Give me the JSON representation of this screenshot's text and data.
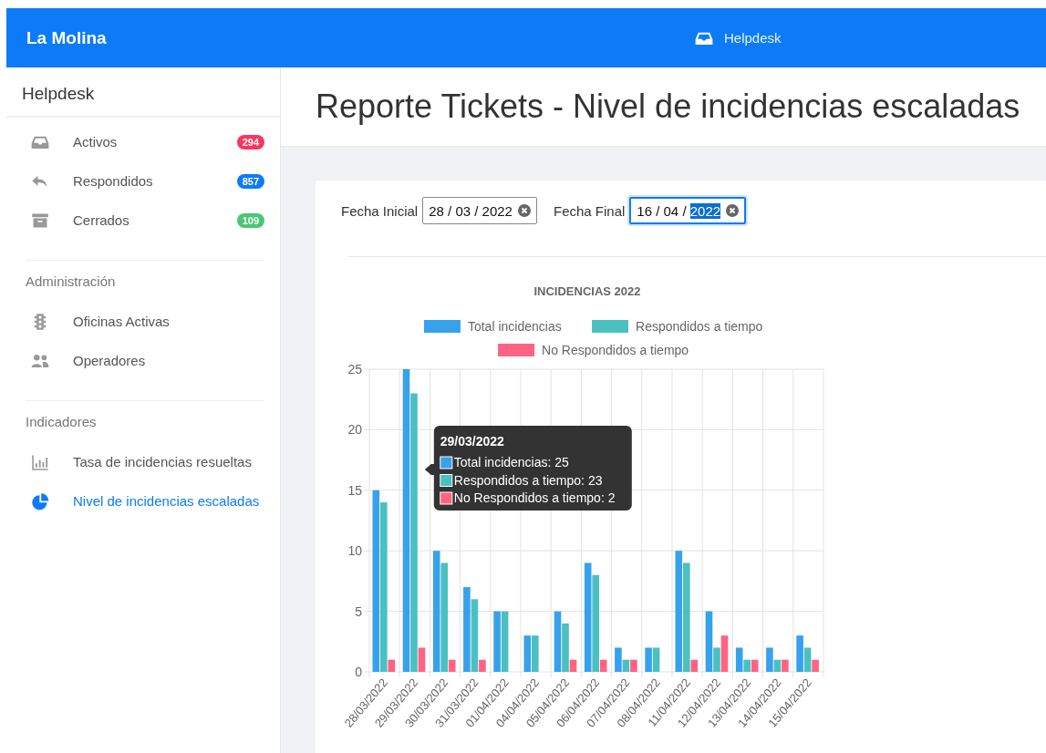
{
  "topbar": {
    "brand": "La Molina",
    "center_label": "Helpdesk"
  },
  "sidebar": {
    "title": "Helpdesk",
    "sections": [
      {
        "items": [
          {
            "label": "Activos",
            "kind": "inbox",
            "badge": "294",
            "color": "#f8355f",
            "selected": false
          },
          {
            "label": "Respondidos",
            "kind": "reply",
            "badge": "857",
            "color": "#0d7bf7",
            "selected": false
          },
          {
            "label": "Cerrados",
            "kind": "archive",
            "badge": "109",
            "color": "#48c774",
            "selected": false
          }
        ]
      },
      {
        "heading": "Administración",
        "items": [
          {
            "label": "Oficinas Activas",
            "kind": "traffic",
            "selected": false
          },
          {
            "label": "Operadores",
            "kind": "users",
            "selected": false
          }
        ]
      },
      {
        "heading": "Indicadores",
        "items": [
          {
            "label": "Tasa de incidencias resueltas",
            "kind": "bars",
            "selected": false
          },
          {
            "label": "Nivel de incidencias escaladas",
            "kind": "pie",
            "selected": true
          }
        ]
      }
    ]
  },
  "page": {
    "title": "Reporte Tickets - Nivel de incidencias escaladas"
  },
  "filters": [
    {
      "label": "Fecha Inicial",
      "focused": false,
      "segments": [
        {
          "text": "28 / 03 / 2022",
          "selected": false
        }
      ]
    },
    {
      "label": "Fecha Final",
      "focused": true,
      "segments": [
        {
          "text": "16 / 04 / ",
          "selected": false
        },
        {
          "text": "2022",
          "selected": true
        }
      ]
    }
  ],
  "chart": {
    "chart_data": {
      "type": "bar",
      "title": "INCIDENCIAS 2022",
      "categories": [
        "28/03/2022",
        "29/03/2022",
        "30/03/2022",
        "31/03/2022",
        "01/04/2022",
        "04/04/2022",
        "05/04/2022",
        "06/04/2022",
        "07/04/2022",
        "08/04/2022",
        "11/04/2022",
        "12/04/2022",
        "13/04/2022",
        "14/04/2022",
        "15/04/2022"
      ],
      "series": [
        {
          "name": "Total incidencias",
          "color": "#36a2eb",
          "values": [
            15,
            25,
            10,
            7,
            5,
            3,
            5,
            9,
            2,
            2,
            10,
            5,
            2,
            2,
            3
          ]
        },
        {
          "name": "Respondidos a tiempo",
          "color": "#4bc0c0",
          "values": [
            14,
            23,
            9,
            6,
            5,
            3,
            4,
            8,
            1,
            2,
            9,
            2,
            1,
            1,
            2
          ]
        },
        {
          "name": "No Respondidos a tiempo",
          "color": "#ff6384",
          "values": [
            1,
            2,
            1,
            1,
            0,
            0,
            1,
            1,
            1,
            0,
            1,
            3,
            1,
            1,
            1
          ]
        }
      ],
      "ylim": [
        0,
        25
      ],
      "grid": true,
      "legend": true,
      "yticks": [
        0,
        5,
        10,
        15,
        20,
        25
      ]
    },
    "tooltip": {
      "title": "29/03/2022",
      "lines": [
        {
          "text": "Total incidencias: 25",
          "color": "#36a2eb"
        },
        {
          "text": "Respondidos a tiempo: 23",
          "color": "#4bc0c0"
        },
        {
          "text": "No Respondidos a tiempo: 2",
          "color": "#ff6384"
        }
      ]
    }
  }
}
